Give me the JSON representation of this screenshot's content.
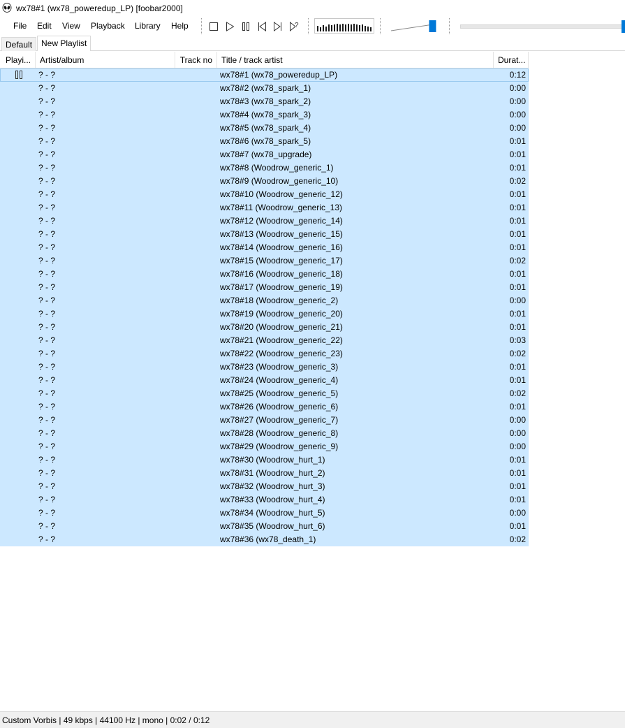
{
  "window": {
    "title": "wx78#1 (wx78_poweredup_LP)  [foobar2000]",
    "icon": "alien-icon"
  },
  "menu": {
    "items": [
      "File",
      "Edit",
      "View",
      "Playback",
      "Library",
      "Help"
    ]
  },
  "toolbar": {
    "buttons": [
      {
        "name": "stop-button",
        "icon": "stop-icon"
      },
      {
        "name": "play-button",
        "icon": "play-icon"
      },
      {
        "name": "pause-button",
        "icon": "pause-icon"
      },
      {
        "name": "previous-button",
        "icon": "previous-icon"
      },
      {
        "name": "next-button",
        "icon": "next-icon"
      },
      {
        "name": "random-button",
        "icon": "random-icon"
      }
    ],
    "volume_level": 0.9,
    "seek_position": 1.0,
    "accent_color": "#0078d7"
  },
  "tabs": [
    {
      "label": "Default",
      "active": false
    },
    {
      "label": "New Playlist",
      "active": true
    }
  ],
  "columns": {
    "playing": "Playi...",
    "artist": "Artist/album",
    "track": "Track no",
    "title": "Title / track artist",
    "duration": "Durat..."
  },
  "rows": [
    {
      "artist": "? - ?",
      "title": "wx78#1 (wx78_poweredup_LP)",
      "duration": "0:12",
      "playing": true
    },
    {
      "artist": "? - ?",
      "title": "wx78#2 (wx78_spark_1)",
      "duration": "0:00"
    },
    {
      "artist": "? - ?",
      "title": "wx78#3 (wx78_spark_2)",
      "duration": "0:00"
    },
    {
      "artist": "? - ?",
      "title": "wx78#4 (wx78_spark_3)",
      "duration": "0:00"
    },
    {
      "artist": "? - ?",
      "title": "wx78#5 (wx78_spark_4)",
      "duration": "0:00"
    },
    {
      "artist": "? - ?",
      "title": "wx78#6 (wx78_spark_5)",
      "duration": "0:01"
    },
    {
      "artist": "? - ?",
      "title": "wx78#7 (wx78_upgrade)",
      "duration": "0:01"
    },
    {
      "artist": "? - ?",
      "title": "wx78#8 (Woodrow_generic_1)",
      "duration": "0:01"
    },
    {
      "artist": "? - ?",
      "title": "wx78#9 (Woodrow_generic_10)",
      "duration": "0:02"
    },
    {
      "artist": "? - ?",
      "title": "wx78#10 (Woodrow_generic_12)",
      "duration": "0:01"
    },
    {
      "artist": "? - ?",
      "title": "wx78#11 (Woodrow_generic_13)",
      "duration": "0:01"
    },
    {
      "artist": "? - ?",
      "title": "wx78#12 (Woodrow_generic_14)",
      "duration": "0:01"
    },
    {
      "artist": "? - ?",
      "title": "wx78#13 (Woodrow_generic_15)",
      "duration": "0:01"
    },
    {
      "artist": "? - ?",
      "title": "wx78#14 (Woodrow_generic_16)",
      "duration": "0:01"
    },
    {
      "artist": "? - ?",
      "title": "wx78#15 (Woodrow_generic_17)",
      "duration": "0:02"
    },
    {
      "artist": "? - ?",
      "title": "wx78#16 (Woodrow_generic_18)",
      "duration": "0:01"
    },
    {
      "artist": "? - ?",
      "title": "wx78#17 (Woodrow_generic_19)",
      "duration": "0:01"
    },
    {
      "artist": "? - ?",
      "title": "wx78#18 (Woodrow_generic_2)",
      "duration": "0:00"
    },
    {
      "artist": "? - ?",
      "title": "wx78#19 (Woodrow_generic_20)",
      "duration": "0:01"
    },
    {
      "artist": "? - ?",
      "title": "wx78#20 (Woodrow_generic_21)",
      "duration": "0:01"
    },
    {
      "artist": "? - ?",
      "title": "wx78#21 (Woodrow_generic_22)",
      "duration": "0:03"
    },
    {
      "artist": "? - ?",
      "title": "wx78#22 (Woodrow_generic_23)",
      "duration": "0:02"
    },
    {
      "artist": "? - ?",
      "title": "wx78#23 (Woodrow_generic_3)",
      "duration": "0:01"
    },
    {
      "artist": "? - ?",
      "title": "wx78#24 (Woodrow_generic_4)",
      "duration": "0:01"
    },
    {
      "artist": "? - ?",
      "title": "wx78#25 (Woodrow_generic_5)",
      "duration": "0:02"
    },
    {
      "artist": "? - ?",
      "title": "wx78#26 (Woodrow_generic_6)",
      "duration": "0:01"
    },
    {
      "artist": "? - ?",
      "title": "wx78#27 (Woodrow_generic_7)",
      "duration": "0:00"
    },
    {
      "artist": "? - ?",
      "title": "wx78#28 (Woodrow_generic_8)",
      "duration": "0:00"
    },
    {
      "artist": "? - ?",
      "title": "wx78#29 (Woodrow_generic_9)",
      "duration": "0:00"
    },
    {
      "artist": "? - ?",
      "title": "wx78#30 (Woodrow_hurt_1)",
      "duration": "0:01"
    },
    {
      "artist": "? - ?",
      "title": "wx78#31 (Woodrow_hurt_2)",
      "duration": "0:01"
    },
    {
      "artist": "? - ?",
      "title": "wx78#32 (Woodrow_hurt_3)",
      "duration": "0:01"
    },
    {
      "artist": "? - ?",
      "title": "wx78#33 (Woodrow_hurt_4)",
      "duration": "0:01"
    },
    {
      "artist": "? - ?",
      "title": "wx78#34 (Woodrow_hurt_5)",
      "duration": "0:00"
    },
    {
      "artist": "? - ?",
      "title": "wx78#35 (Woodrow_hurt_6)",
      "duration": "0:01"
    },
    {
      "artist": "? - ?",
      "title": "wx78#36 (wx78_death_1)",
      "duration": "0:02"
    }
  ],
  "selection_color": "#cce8ff",
  "status": {
    "text": "Custom Vorbis | 49 kbps | 44100 Hz | mono | 0:02 / 0:12"
  }
}
